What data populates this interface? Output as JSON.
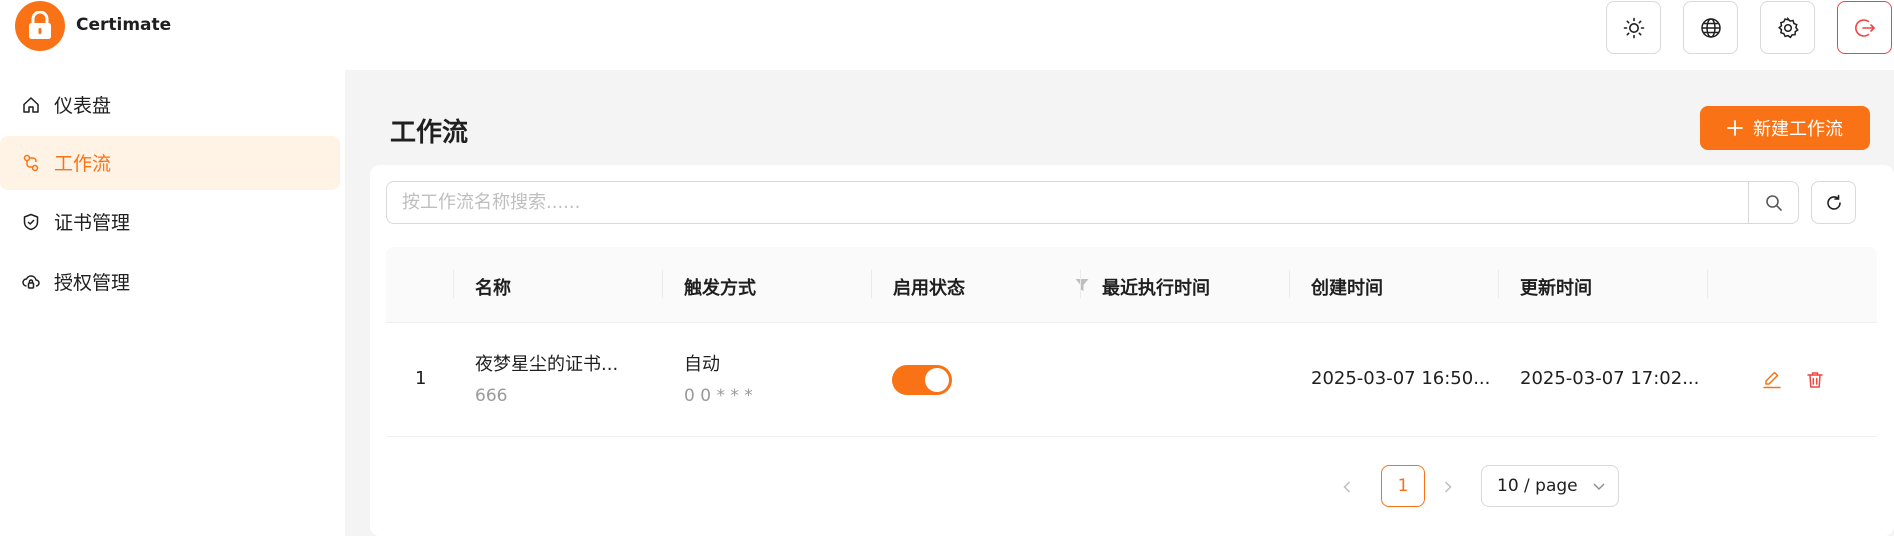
{
  "app": {
    "name": "Certimate",
    "accent": "#f97316",
    "danger": "#ef4444"
  },
  "header": {
    "buttons": [
      {
        "name": "theme-toggle",
        "icon": "sun-icon"
      },
      {
        "name": "language",
        "icon": "globe-icon"
      },
      {
        "name": "settings",
        "icon": "gear-icon"
      },
      {
        "name": "logout",
        "icon": "logout-icon"
      }
    ]
  },
  "sidebar": {
    "items": [
      {
        "label": "仪表盘",
        "icon": "home-icon",
        "active": false
      },
      {
        "label": "工作流",
        "icon": "workflow-icon",
        "active": true
      },
      {
        "label": "证书管理",
        "icon": "shield-check-icon",
        "active": false
      },
      {
        "label": "授权管理",
        "icon": "cloud-lock-icon",
        "active": false
      }
    ]
  },
  "main": {
    "title": "工作流",
    "new_button_label": "新建工作流",
    "search": {
      "placeholder": "按工作流名称搜索......",
      "value": ""
    },
    "table": {
      "columns": [
        "名称",
        "触发方式",
        "启用状态",
        "最近执行时间",
        "创建时间",
        "更新时间"
      ],
      "rows": [
        {
          "index": "1",
          "name": "夜梦星尘的证书...",
          "description": "666",
          "trigger": "自动",
          "cron": "0 0 * * *",
          "enabled": true,
          "last_run": "",
          "created": "2025-03-07 16:50...",
          "updated": "2025-03-07 17:02..."
        }
      ]
    },
    "pagination": {
      "current": "1",
      "page_size": "10 / page"
    }
  }
}
